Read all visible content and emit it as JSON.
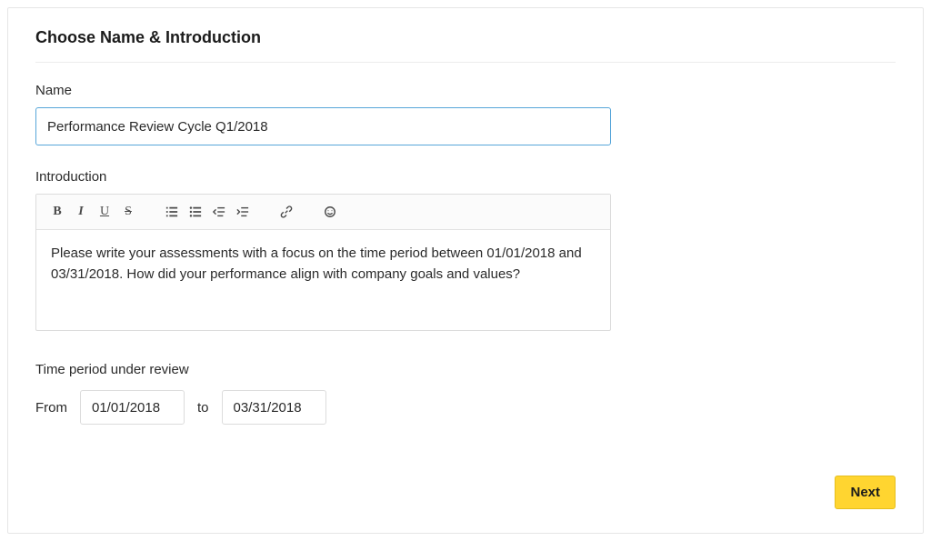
{
  "section_title": "Choose Name & Introduction",
  "name": {
    "label": "Name",
    "value": "Performance Review Cycle Q1/2018"
  },
  "introduction": {
    "label": "Introduction",
    "content": "Please write your assessments with a focus on the time period between 01/01/2018 and 03/31/2018. How did your performance align with company goals and values?",
    "toolbar": {
      "bold": "B",
      "italic": "I",
      "underline": "U",
      "strike": "S"
    }
  },
  "time_period": {
    "label": "Time period under review",
    "from_label": "From",
    "to_label": "to",
    "from_value": "01/01/2018",
    "to_value": "03/31/2018"
  },
  "next_button": "Next"
}
